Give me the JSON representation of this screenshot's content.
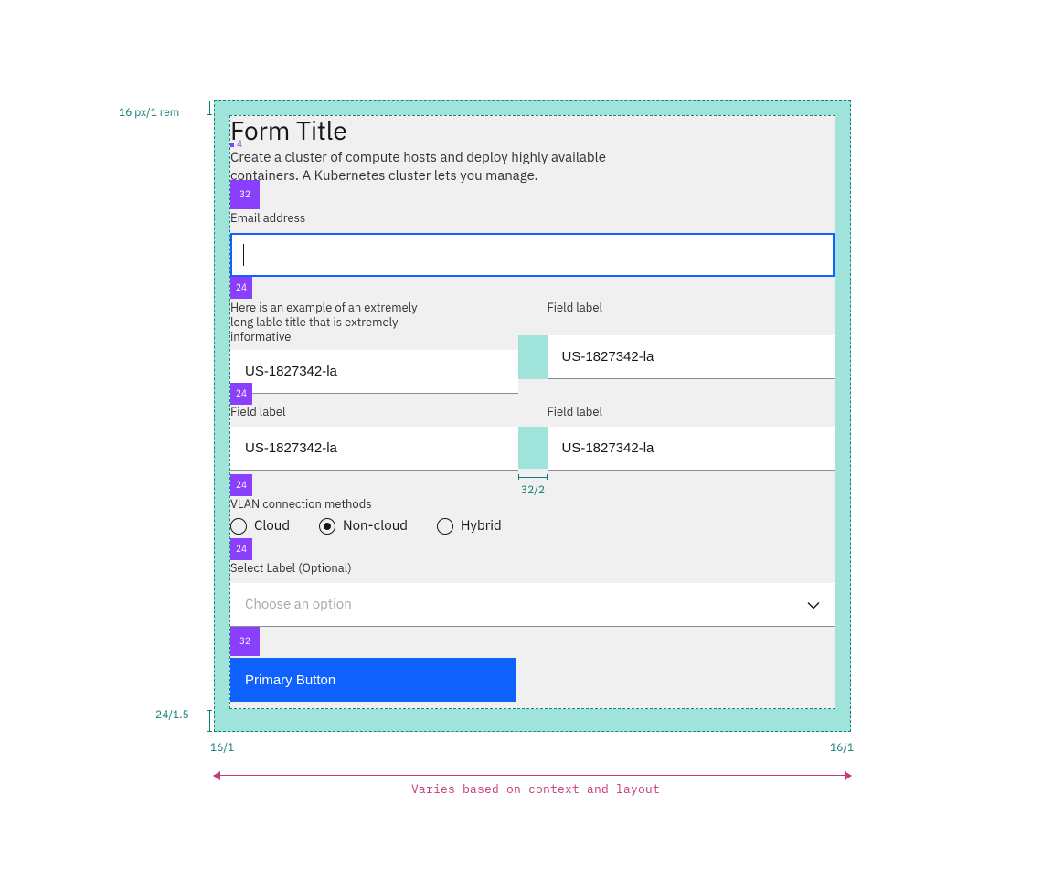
{
  "form": {
    "title": "Form Title",
    "description": "Create a cluster of compute hosts and deploy highly available containers. A Kubernetes cluster lets you manage.",
    "email": {
      "label": "Email address",
      "value": ""
    },
    "row1": {
      "left": {
        "label": "Here is an example of an extremely long lable title that is extremely informative",
        "value": "US-1827342-la"
      },
      "right": {
        "label": "Field label",
        "value": "US-1827342-la"
      }
    },
    "row2": {
      "left": {
        "label": "Field label",
        "value": "US-1827342-la"
      },
      "right": {
        "label": "Field label",
        "value": "US-1827342-la"
      }
    },
    "vlan": {
      "label": "VLAN connection methods",
      "options": {
        "cloud": "Cloud",
        "noncloud": "Non-cloud",
        "hybrid": "Hybrid"
      },
      "selected": "noncloud"
    },
    "select": {
      "label": "Select Label (Optional)",
      "placeholder": "Choose an option"
    },
    "primary_button": "Primary Button"
  },
  "spacers": {
    "s4": "4",
    "s24": "24",
    "s32": "32",
    "gutter": "32/2"
  },
  "annotations": {
    "top": "16 px/1 rem",
    "left": "24/1.5",
    "inner_left": "16/1",
    "inner_right": "16/1",
    "caption": "Varies based on context and layout"
  }
}
